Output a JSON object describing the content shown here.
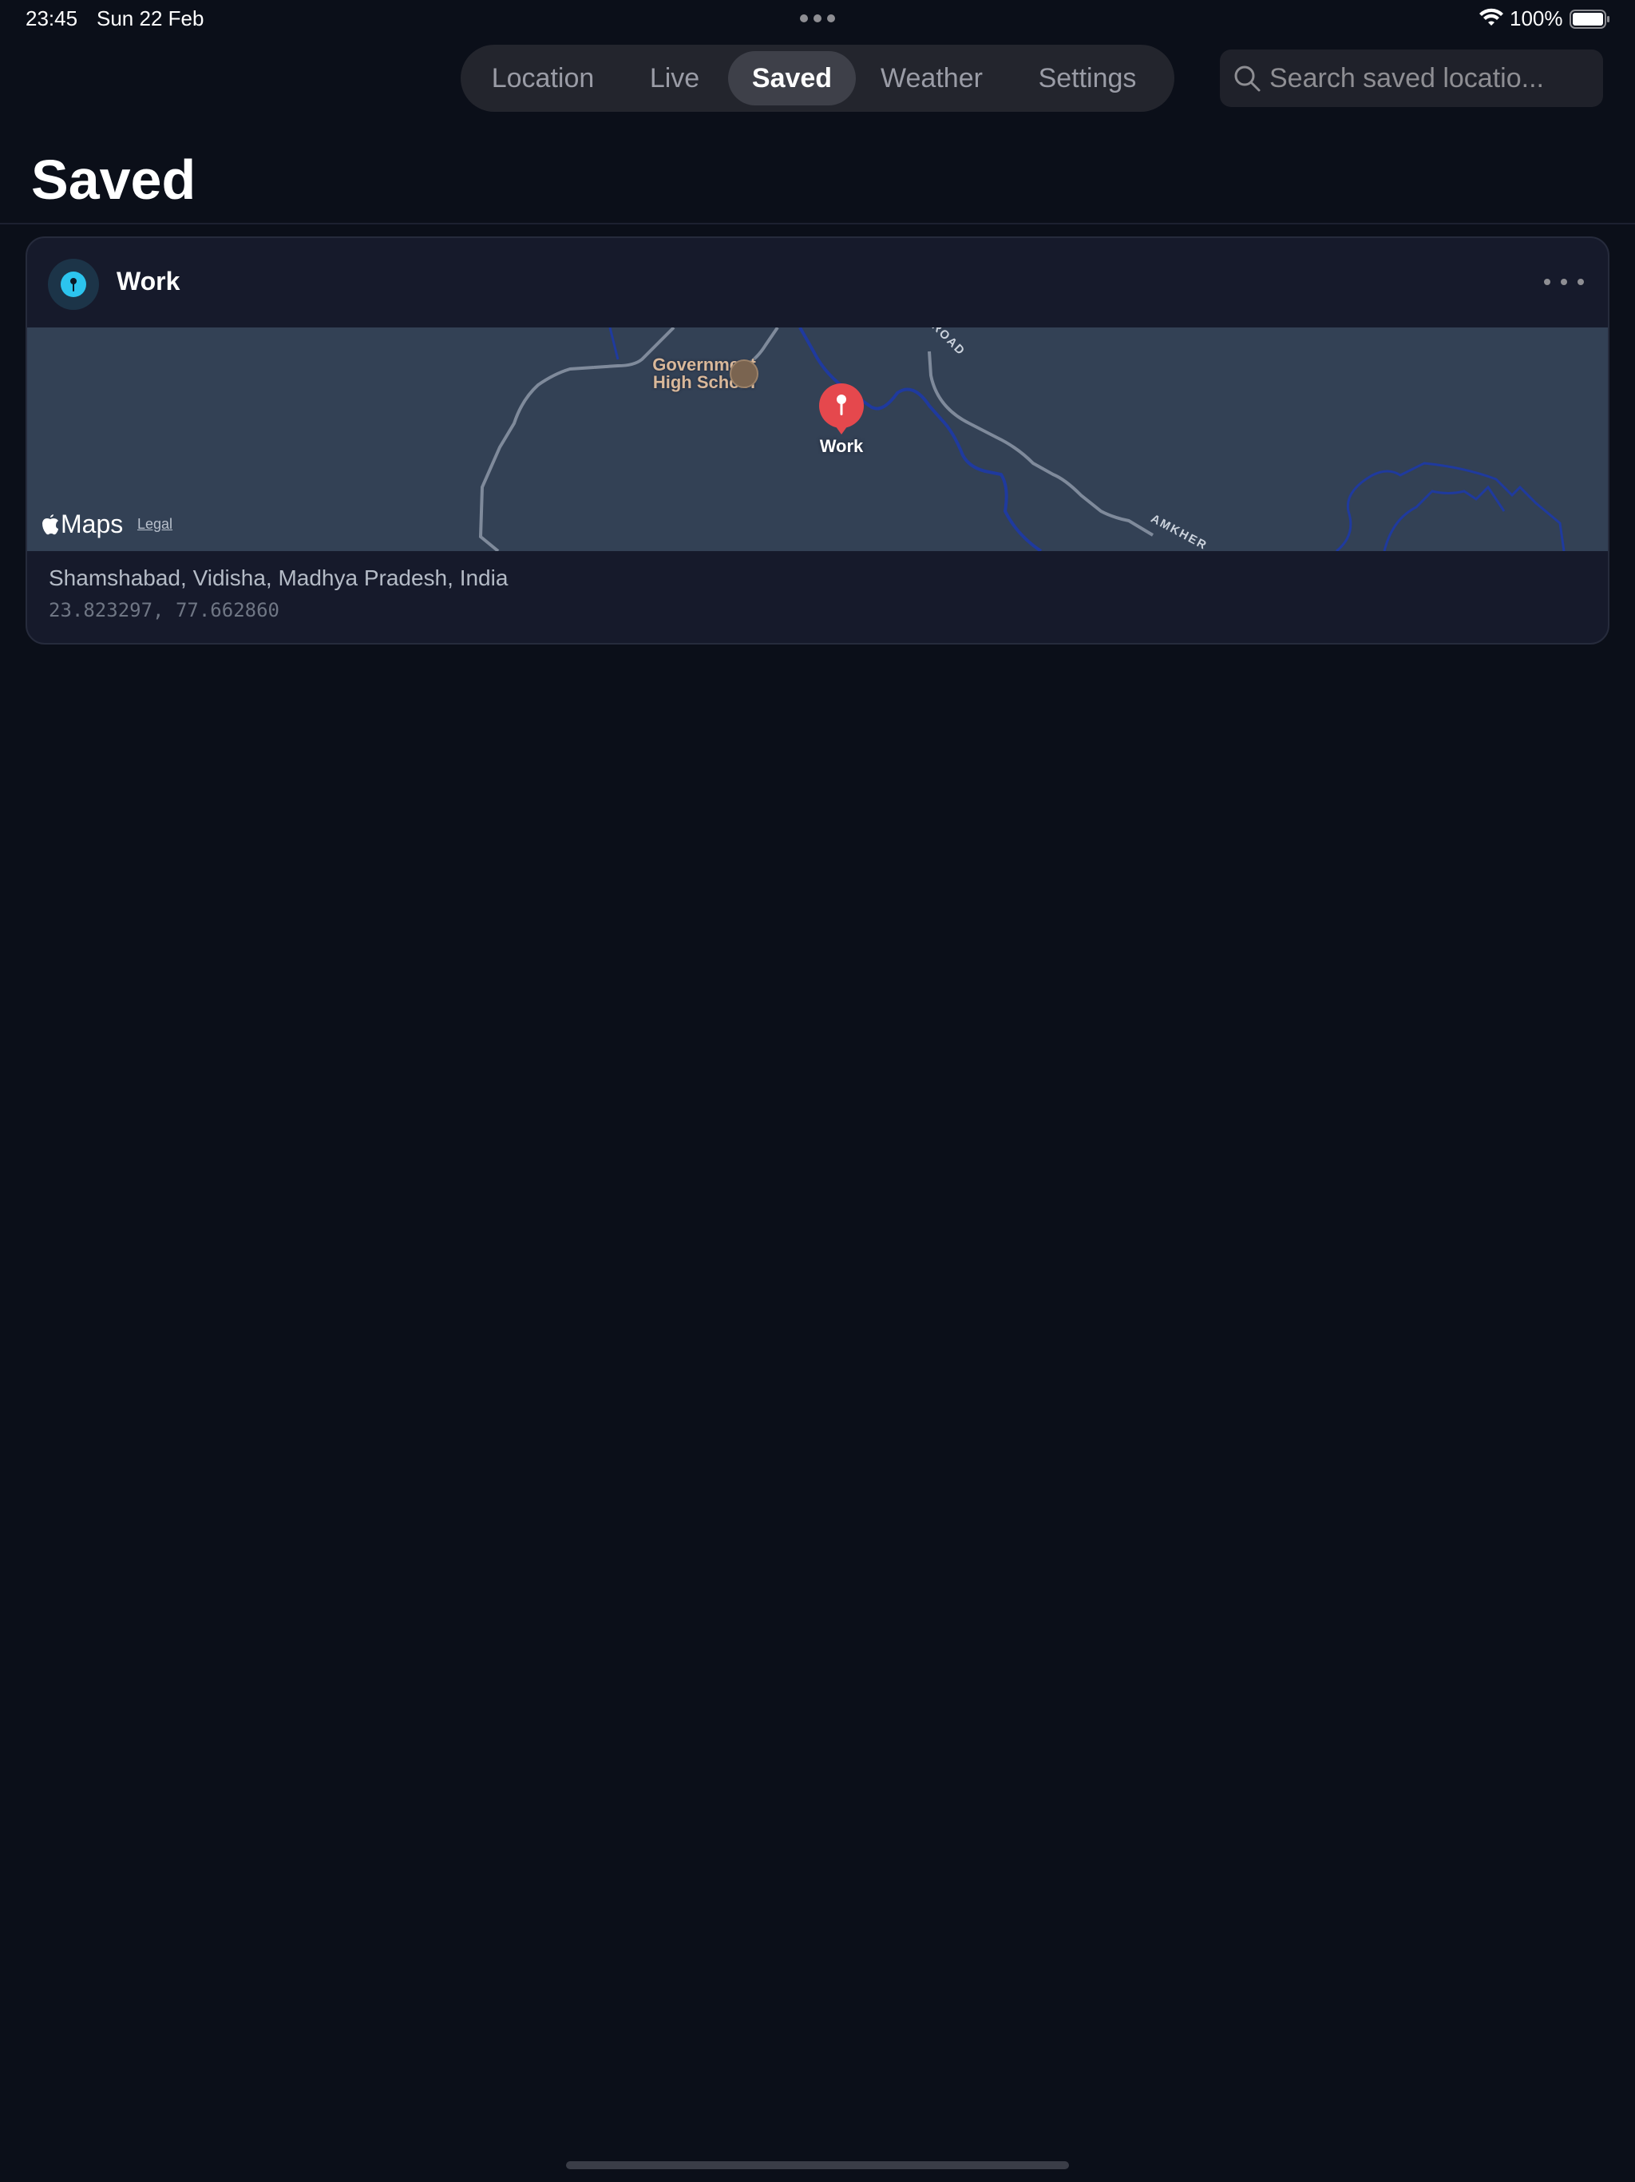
{
  "status_bar": {
    "time": "23:45",
    "date": "Sun 22 Feb",
    "battery_percent": "100%",
    "battery_level": 1.0
  },
  "nav": {
    "tabs": [
      {
        "label": "Location",
        "active": false
      },
      {
        "label": "Live",
        "active": false
      },
      {
        "label": "Saved",
        "active": true
      },
      {
        "label": "Weather",
        "active": false
      },
      {
        "label": "Settings",
        "active": false
      }
    ]
  },
  "search": {
    "placeholder": "Search saved locatio..."
  },
  "page": {
    "title": "Saved"
  },
  "saved_locations": [
    {
      "name": "Work",
      "icon": "pin-icon",
      "address": "Shamshabad, Vidisha, Madhya Pradesh, India",
      "coordinates": "23.823297, 77.662860",
      "map": {
        "poi_label_line1": "Government",
        "poi_label_line2": "High School",
        "road_label_1": "ROAD",
        "road_label_2": "AMKHER",
        "pin_label": "Work",
        "attribution": "Maps",
        "legal": "Legal"
      }
    }
  ],
  "colors": {
    "background": "#0b0f19",
    "card": "#161a2b",
    "accent": "#2cc4ee",
    "pin": "#e5484d",
    "map_water": "#1f3a9e"
  }
}
